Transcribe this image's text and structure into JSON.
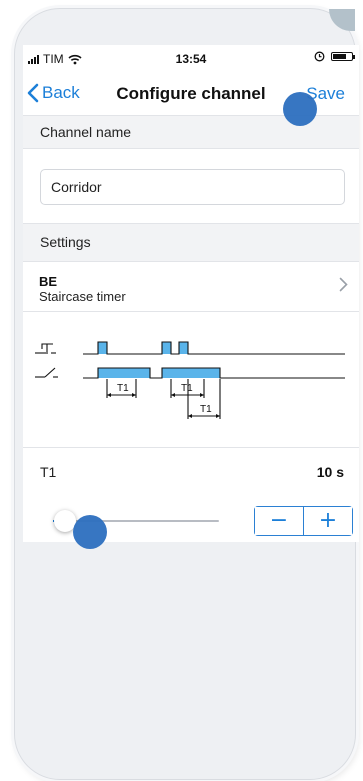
{
  "status_bar": {
    "carrier": "TIM",
    "time": "13:54"
  },
  "nav": {
    "back_label": "Back",
    "title": "Configure channel",
    "save_label": "Save"
  },
  "channel_name": {
    "header": "Channel name",
    "value": "Corridor"
  },
  "settings": {
    "header": "Settings",
    "item": {
      "code": "BE",
      "description": "Staircase timer"
    }
  },
  "diagram": {
    "labels": [
      "T1",
      "T1",
      "T1"
    ]
  },
  "t1": {
    "label": "T1",
    "value": "10 s",
    "slider_fraction": 0.07,
    "stepper_minus": "−",
    "stepper_plus": "+"
  },
  "colors": {
    "accent": "#1c7fd8",
    "pulse_fill": "#5ab4ea",
    "touch_marker": "#2c6fbf"
  },
  "icons": [
    "wifi-icon",
    "signal-icon",
    "battery-icon",
    "alarm-icon",
    "back-chevron-icon",
    "chevron-right-icon"
  ]
}
